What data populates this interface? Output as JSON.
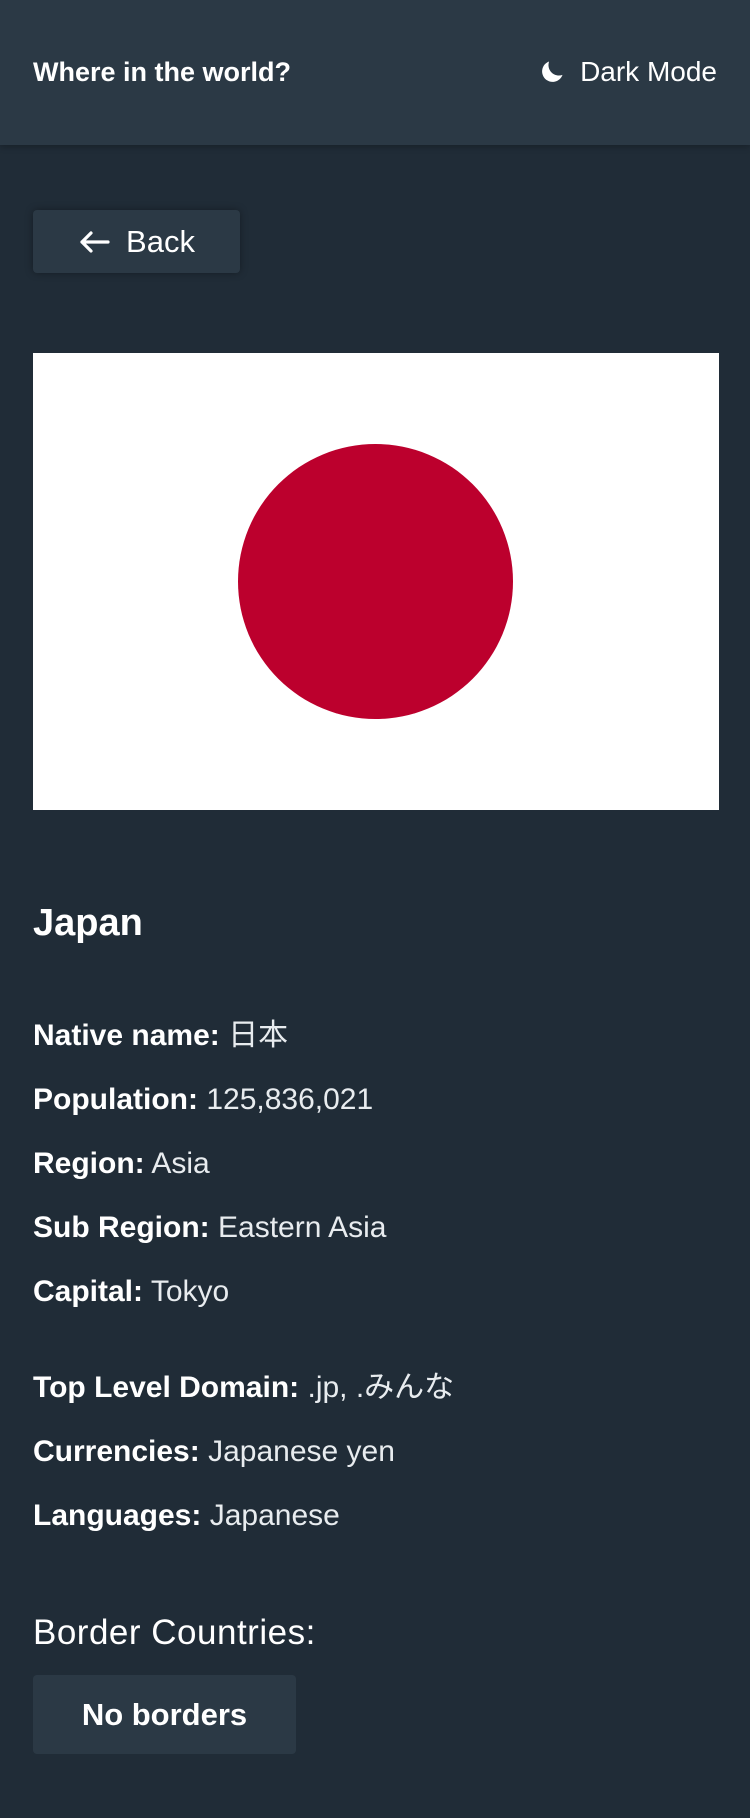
{
  "header": {
    "title": "Where in the world?",
    "theme_toggle_label": "Dark Mode",
    "theme_toggle_icon": "moon-icon"
  },
  "back_button": {
    "label": "Back",
    "icon": "arrow-left-icon"
  },
  "flag": {
    "description_icon": "japan-flag",
    "field_color": "#ffffff",
    "disc_color": "#bc002d"
  },
  "country": {
    "name": "Japan",
    "native_name_label": "Native name:",
    "native_name": "日本",
    "population_label": "Population:",
    "population": "125,836,021",
    "region_label": "Region:",
    "region": "Asia",
    "sub_region_label": "Sub Region:",
    "sub_region": "Eastern Asia",
    "capital_label": "Capital:",
    "capital": "Tokyo",
    "tld_label": "Top Level Domain:",
    "tld": ".jp, .みんな",
    "currencies_label": "Currencies:",
    "currencies": "Japanese yen",
    "languages_label": "Languages:",
    "languages": "Japanese"
  },
  "borders": {
    "title": "Border Countries:",
    "empty_label": "No borders"
  },
  "colors": {
    "background": "#202c37",
    "element": "#2b3945",
    "text": "#ffffff"
  }
}
